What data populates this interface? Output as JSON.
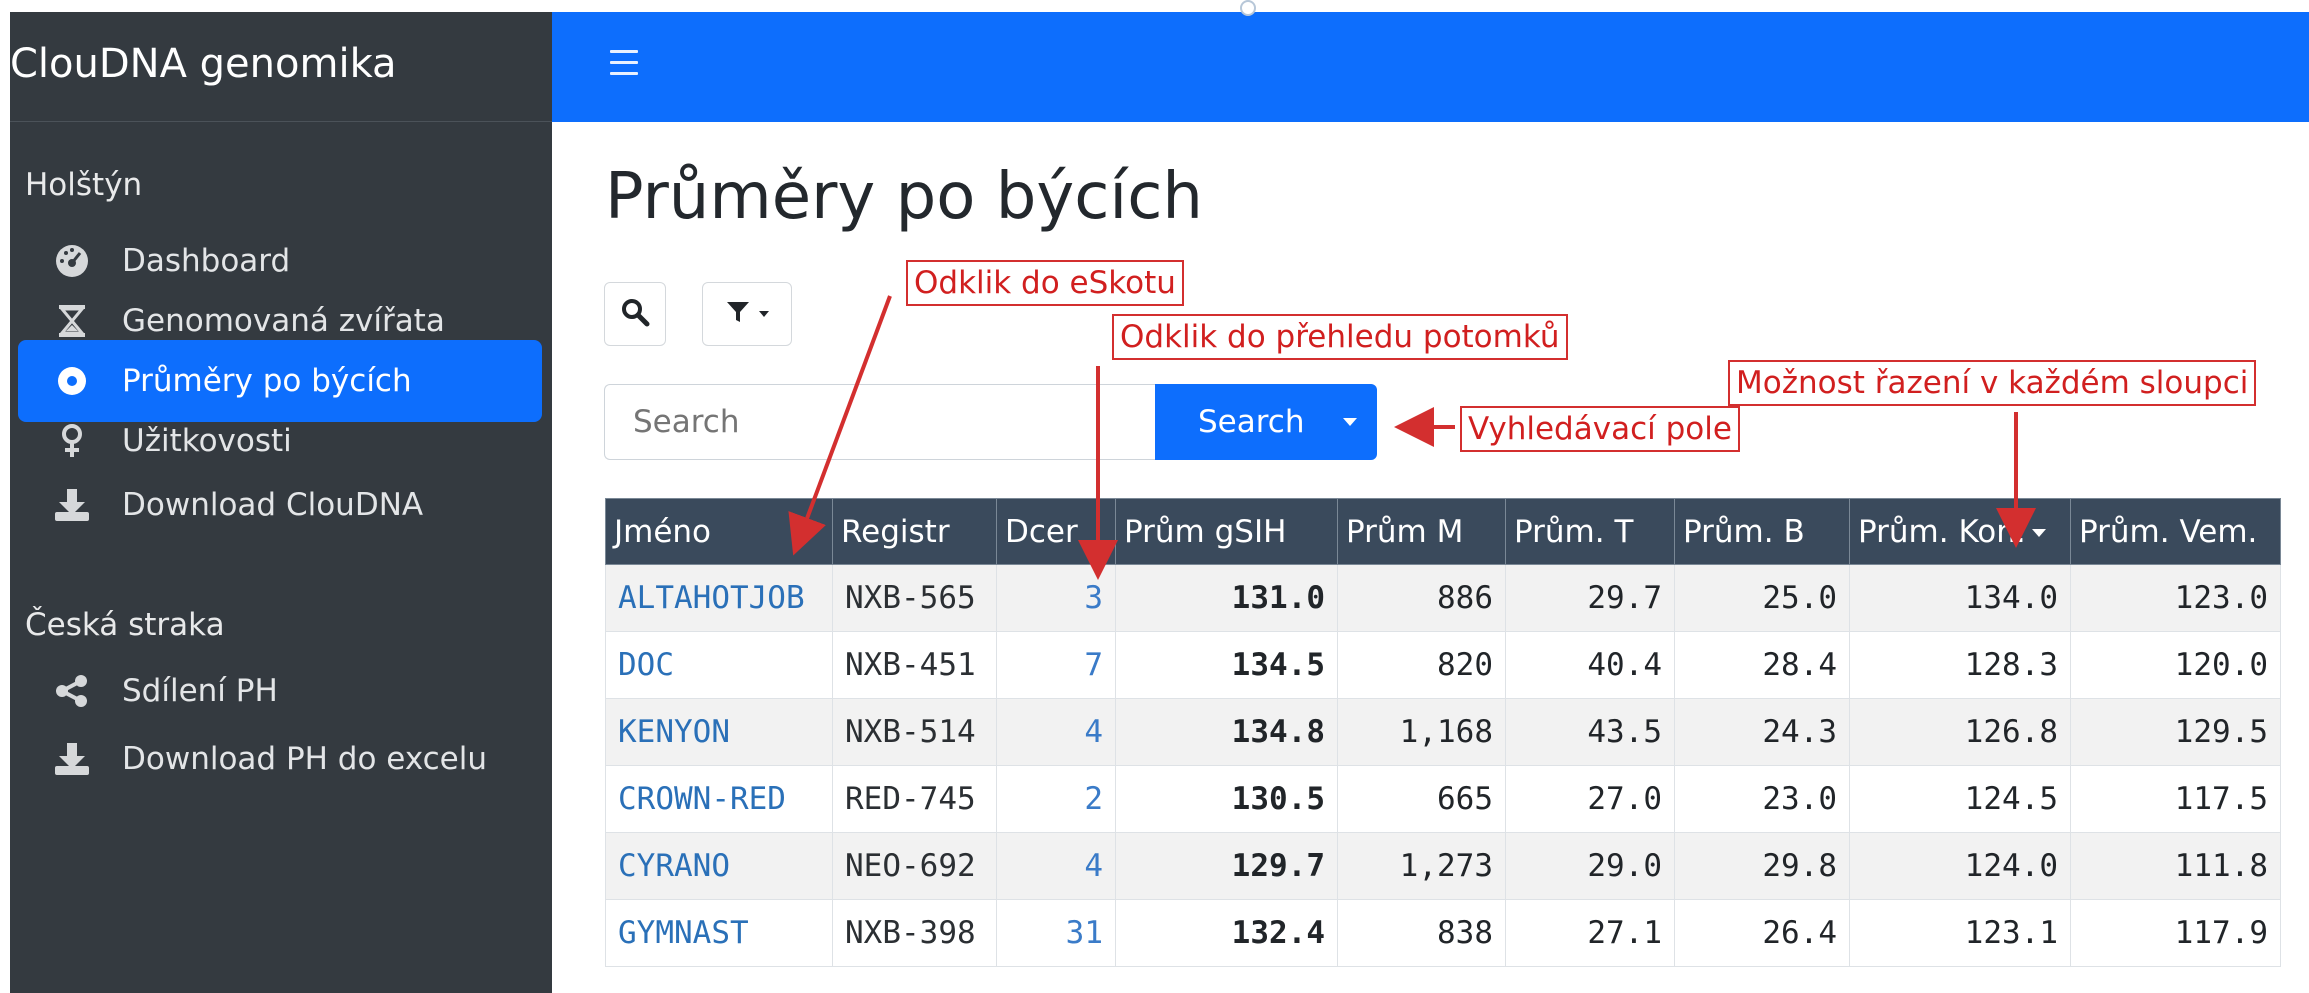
{
  "app": {
    "brand": "ClouDNA genomika"
  },
  "sidebar": {
    "sections": [
      {
        "title": "Holštýn",
        "items": [
          {
            "label": "Dashboard",
            "icon": "dashboard-gauge-icon",
            "active": false
          },
          {
            "label": "Genomovaná zvířata",
            "icon": "hourglass-icon",
            "active": false
          },
          {
            "label": "Průměry po býcích",
            "icon": "circle-dot-icon",
            "active": true
          },
          {
            "label": "Užitkovosti",
            "icon": "female-symbol-icon",
            "active": false
          },
          {
            "label": "Download ClouDNA",
            "icon": "download-icon",
            "active": false
          }
        ]
      },
      {
        "title": "Česká straka",
        "items": [
          {
            "label": "Sdílení PH",
            "icon": "share-icon",
            "active": false
          },
          {
            "label": "Download PH do excelu",
            "icon": "download-icon",
            "active": false
          }
        ]
      }
    ]
  },
  "main": {
    "title": "Průměry po býcích",
    "search": {
      "placeholder": "Search",
      "button_label": "Search"
    },
    "table": {
      "columns": [
        "Jméno",
        "Registr",
        "Dcer",
        "Prům gSIH",
        "Prům M",
        "Prům. T",
        "Prům. B",
        "Prům. Kon.",
        "Prům. Vem."
      ],
      "rows": [
        [
          "ALTAHOTJOB",
          "NXB-565",
          "3",
          "131.0",
          "886",
          "29.7",
          "25.0",
          "134.0",
          "123.0"
        ],
        [
          "DOC",
          "NXB-451",
          "7",
          "134.5",
          "820",
          "40.4",
          "28.4",
          "128.3",
          "120.0"
        ],
        [
          "KENYON",
          "NXB-514",
          "4",
          "134.8",
          "1,168",
          "43.5",
          "24.3",
          "126.8",
          "129.5"
        ],
        [
          "CROWN-RED",
          "RED-745",
          "2",
          "130.5",
          "665",
          "27.0",
          "23.0",
          "124.5",
          "117.5"
        ],
        [
          "CYRANO",
          "NEO-692",
          "4",
          "129.7",
          "1,273",
          "29.0",
          "29.8",
          "124.0",
          "111.8"
        ],
        [
          "GYMNAST",
          "NXB-398",
          "31",
          "132.4",
          "838",
          "27.1",
          "26.4",
          "123.1",
          "117.9"
        ]
      ]
    }
  },
  "annotations": {
    "eskot": "Odklik do eSkotu",
    "offspring": "Odklik do přehledu potomků",
    "sorting": "Možnost řazení v každém sloupci",
    "search_field": "Vyhledávací pole"
  },
  "colors": {
    "sidebar_bg": "#343a40",
    "accent": "#0d6efd",
    "table_header": "#3a4a5c",
    "annotation": "#d32f2f",
    "link": "#2a70b8"
  }
}
